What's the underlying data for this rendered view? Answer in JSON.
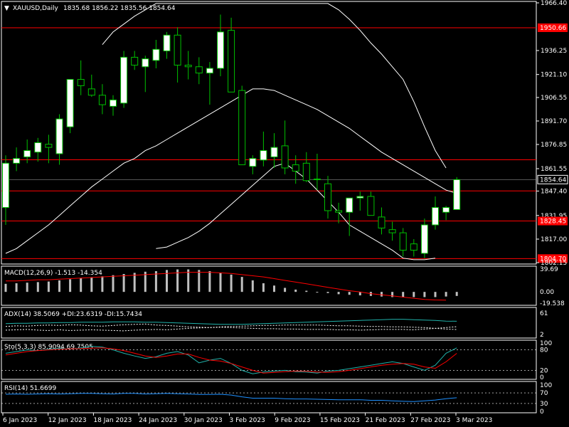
{
  "colors": {
    "background": "#000000",
    "frame": "#ffffff",
    "candle_up": "#ffffff",
    "candle_down": "#000000",
    "wick": "#00c000",
    "bands": "#ffffff",
    "level_line": "#ff0000",
    "level_label_bg": "#ff0000",
    "last_price_bg": "#000000",
    "macd_hist": "#c0c0c0",
    "macd_signal": "#ff0000",
    "adx_main": "#20b2aa",
    "adx_plus": "#ffffff",
    "adx_minus": "#ffffff",
    "sto_main": "#20b2aa",
    "sto_signal": "#ff0000",
    "rsi": "#1e90ff",
    "sep": "#ffffff"
  },
  "header": {
    "symbol": "XAUUSD,Daily",
    "ohlc": "1835.68 1856.22 1835.56 1854.64"
  },
  "price_axis": [
    "1966.40",
    "1950.66",
    "1936.25",
    "1921.10",
    "1906.55",
    "1891.70",
    "1876.85",
    "1861.55",
    "1854.64",
    "1847.40",
    "1831.95",
    "1828.45",
    "1817.00",
    "1804.70",
    "1802.15"
  ],
  "levels": [
    {
      "price": 1950.66,
      "label": "1950.66"
    },
    {
      "price": 1867.17,
      "label": "1867.17"
    },
    {
      "price": 1847.49,
      "label": "1847.49"
    },
    {
      "price": 1828.45,
      "label": "1828.45"
    },
    {
      "price": 1804.7,
      "label": "1804.70"
    }
  ],
  "last_price": "1854.64",
  "time_axis": [
    "6 Jan 2023",
    "12 Jan 2023",
    "18 Jan 2023",
    "24 Jan 2023",
    "30 Jan 2023",
    "3 Feb 2023",
    "9 Feb 2023",
    "15 Feb 2023",
    "21 Feb 2023",
    "27 Feb 2023",
    "3 Mar 2023"
  ],
  "macd": {
    "label": "MACD(12,26,9) -1.513 -14.354",
    "axis": [
      "39.69",
      "0.00",
      "-19.538"
    ]
  },
  "adx": {
    "label": "ADX(14) 38.5069 +DI:23.6319 -DI:15.7434",
    "axis": [
      "61",
      "2"
    ]
  },
  "sto": {
    "label": "Sto(5,3,3) 85.9094 69.7505",
    "axis": [
      "100",
      "80",
      "20",
      "0"
    ]
  },
  "rsi": {
    "label": "RSI(14) 51.6699",
    "axis": [
      "100",
      "70",
      "30",
      "0"
    ]
  },
  "chart_data": {
    "type": "candlestick",
    "title": "XAUUSD,Daily",
    "ylim": [
      1802.15,
      1966.4
    ],
    "candles": [
      {
        "o": 1837,
        "h": 1870,
        "l": 1826,
        "c": 1865
      },
      {
        "o": 1865,
        "h": 1875,
        "l": 1860,
        "c": 1868
      },
      {
        "o": 1869,
        "h": 1880,
        "l": 1865,
        "c": 1873
      },
      {
        "o": 1872,
        "h": 1881,
        "l": 1866,
        "c": 1878
      },
      {
        "o": 1877,
        "h": 1883,
        "l": 1865,
        "c": 1875
      },
      {
        "o": 1871,
        "h": 1896,
        "l": 1864,
        "c": 1893
      },
      {
        "o": 1888,
        "h": 1914,
        "l": 1884,
        "c": 1918
      },
      {
        "o": 1918,
        "h": 1930,
        "l": 1908,
        "c": 1914
      },
      {
        "o": 1912,
        "h": 1921,
        "l": 1907,
        "c": 1908
      },
      {
        "o": 1908,
        "h": 1915,
        "l": 1896,
        "c": 1902
      },
      {
        "o": 1901,
        "h": 1908,
        "l": 1895,
        "c": 1905
      },
      {
        "o": 1903,
        "h": 1936,
        "l": 1900,
        "c": 1932
      },
      {
        "o": 1932,
        "h": 1936,
        "l": 1924,
        "c": 1927
      },
      {
        "o": 1926,
        "h": 1933,
        "l": 1910,
        "c": 1931
      },
      {
        "o": 1930,
        "h": 1943,
        "l": 1925,
        "c": 1937
      },
      {
        "o": 1936,
        "h": 1948,
        "l": 1931,
        "c": 1946
      },
      {
        "o": 1946,
        "h": 1951,
        "l": 1916,
        "c": 1927
      },
      {
        "o": 1927,
        "h": 1936,
        "l": 1918,
        "c": 1926
      },
      {
        "o": 1926,
        "h": 1932,
        "l": 1915,
        "c": 1922
      },
      {
        "o": 1922,
        "h": 1929,
        "l": 1902,
        "c": 1925
      },
      {
        "o": 1925,
        "h": 1959,
        "l": 1920,
        "c": 1948
      },
      {
        "o": 1949,
        "h": 1957,
        "l": 1910,
        "c": 1910
      },
      {
        "o": 1911,
        "h": 1914,
        "l": 1864,
        "c": 1864
      },
      {
        "o": 1863,
        "h": 1870,
        "l": 1858,
        "c": 1868
      },
      {
        "o": 1867,
        "h": 1885,
        "l": 1863,
        "c": 1873
      },
      {
        "o": 1869,
        "h": 1884,
        "l": 1862,
        "c": 1875
      },
      {
        "o": 1876,
        "h": 1892,
        "l": 1858,
        "c": 1862
      },
      {
        "o": 1864,
        "h": 1870,
        "l": 1852,
        "c": 1860
      },
      {
        "o": 1865,
        "h": 1872,
        "l": 1853,
        "c": 1854
      },
      {
        "o": 1855,
        "h": 1871,
        "l": 1848,
        "c": 1855
      },
      {
        "o": 1852,
        "h": 1857,
        "l": 1830,
        "c": 1835
      },
      {
        "o": 1835,
        "h": 1840,
        "l": 1827,
        "c": 1834
      },
      {
        "o": 1834,
        "h": 1843,
        "l": 1819,
        "c": 1843
      },
      {
        "o": 1843,
        "h": 1847,
        "l": 1835,
        "c": 1844
      },
      {
        "o": 1844,
        "h": 1847,
        "l": 1832,
        "c": 1832
      },
      {
        "o": 1831,
        "h": 1837,
        "l": 1820,
        "c": 1824
      },
      {
        "o": 1823,
        "h": 1828,
        "l": 1816,
        "c": 1821
      },
      {
        "o": 1821,
        "h": 1824,
        "l": 1806,
        "c": 1810
      },
      {
        "o": 1814,
        "h": 1817,
        "l": 1806,
        "c": 1810
      },
      {
        "o": 1808,
        "h": 1830,
        "l": 1805,
        "c": 1826
      },
      {
        "o": 1826,
        "h": 1844,
        "l": 1823,
        "c": 1837
      },
      {
        "o": 1834,
        "h": 1838,
        "l": 1829,
        "c": 1837
      },
      {
        "o": 1835.68,
        "h": 1856.22,
        "l": 1835.56,
        "c": 1854.64
      }
    ],
    "bb_upper": [
      1940,
      1948,
      1953,
      1958,
      1962,
      1966,
      1972,
      1976,
      1980,
      1982,
      1983,
      1985,
      1986,
      1986,
      1985,
      1984,
      1984,
      1983,
      1982,
      1978,
      1975,
      1969,
      1962,
      1956,
      1949,
      1941,
      1934,
      1926,
      1918,
      1904,
      1888,
      1873,
      1862
    ],
    "bb_middle": [
      1808,
      1811,
      1816,
      1821,
      1826,
      1832,
      1838,
      1844,
      1850,
      1855,
      1860,
      1865,
      1868,
      1873,
      1876,
      1880,
      1884,
      1888,
      1892,
      1896,
      1900,
      1904,
      1908,
      1912,
      1912,
      1911,
      1908,
      1905,
      1902,
      1899,
      1895,
      1891,
      1887,
      1882,
      1877,
      1872,
      1868,
      1864,
      1860,
      1856,
      1852,
      1848,
      1846
    ],
    "bb_lower": [
      1811,
      1812,
      1815,
      1818,
      1822,
      1827,
      1833,
      1839,
      1845,
      1851,
      1857,
      1863,
      1865,
      1860,
      1855,
      1848,
      1841,
      1834,
      1826,
      1822,
      1818,
      1814,
      1810,
      1805,
      1804,
      1804,
      1805
    ],
    "macd_hist": [
      14,
      15,
      16,
      17,
      18,
      20,
      22,
      24,
      25,
      27,
      29,
      31,
      33,
      35,
      36,
      38,
      39,
      39,
      38,
      36,
      33,
      30,
      26,
      20,
      15,
      11,
      7,
      4,
      2,
      0,
      -2,
      -4,
      -5,
      -6,
      -7,
      -8,
      -9,
      -9,
      -9,
      -9,
      -9,
      -8,
      -7
    ],
    "macd_signal": [
      19,
      19,
      20,
      21,
      21,
      22,
      23,
      24,
      25,
      26,
      27,
      28,
      29,
      30,
      31,
      32,
      33,
      34,
      34,
      34,
      33,
      32,
      30,
      28,
      26,
      23,
      20,
      17,
      14,
      11,
      8,
      5,
      2,
      0,
      -3,
      -5,
      -7,
      -9,
      -11,
      -13,
      -14,
      -14.354
    ],
    "adx_main": [
      32,
      33,
      33,
      34,
      34,
      35,
      35,
      36,
      36,
      36,
      37,
      37,
      37,
      36,
      36,
      35,
      34,
      33,
      32,
      31,
      30,
      30,
      30,
      31,
      32,
      33,
      34,
      35,
      36,
      37,
      38,
      39,
      40,
      41,
      42,
      43,
      44,
      44,
      43,
      42,
      41,
      39,
      38.5
    ],
    "adx_plus": [
      24,
      26,
      25,
      27,
      28,
      27,
      29,
      28,
      26,
      25,
      27,
      29,
      30,
      31,
      28,
      27,
      25,
      23,
      22,
      21,
      22,
      21,
      20,
      19,
      18,
      18,
      17,
      17,
      16,
      16,
      16,
      15,
      15,
      14,
      15,
      16,
      16,
      16,
      15,
      17,
      19,
      21,
      23.6
    ],
    "adx_minus": [
      14,
      15,
      16,
      14,
      13,
      15,
      13,
      14,
      15,
      14,
      13,
      12,
      14,
      15,
      16,
      15,
      17,
      19,
      20,
      21,
      23,
      24,
      25,
      26,
      27,
      27,
      28,
      28,
      28,
      28,
      27,
      26,
      26,
      25,
      24,
      24,
      23,
      23,
      22,
      21,
      19,
      17,
      15.7
    ],
    "sto_main": [
      70,
      75,
      80,
      78,
      82,
      85,
      82,
      86,
      90,
      88,
      80,
      70,
      62,
      55,
      60,
      70,
      75,
      65,
      42,
      50,
      55,
      40,
      20,
      10,
      15,
      18,
      20,
      16,
      15,
      12,
      18,
      20,
      25,
      30,
      35,
      40,
      45,
      40,
      30,
      20,
      35,
      70,
      85.9
    ],
    "sto_signal": [
      65,
      70,
      75,
      78,
      80,
      82,
      83,
      84,
      85,
      86,
      83,
      78,
      70,
      62,
      58,
      62,
      68,
      68,
      58,
      50,
      47,
      40,
      30,
      20,
      12,
      14,
      16,
      18,
      17,
      15,
      14,
      16,
      20,
      25,
      30,
      35,
      38,
      40,
      38,
      30,
      26,
      45,
      69.75
    ],
    "rsi": [
      65,
      66,
      65,
      66,
      67,
      66,
      67,
      68,
      68,
      67,
      66,
      68,
      68,
      66,
      67,
      68,
      67,
      66,
      64,
      64,
      65,
      62,
      55,
      50,
      50,
      50,
      48,
      47,
      47,
      46,
      45,
      44,
      44,
      44,
      42,
      42,
      40,
      38,
      37,
      40,
      43,
      48,
      51.67
    ]
  }
}
